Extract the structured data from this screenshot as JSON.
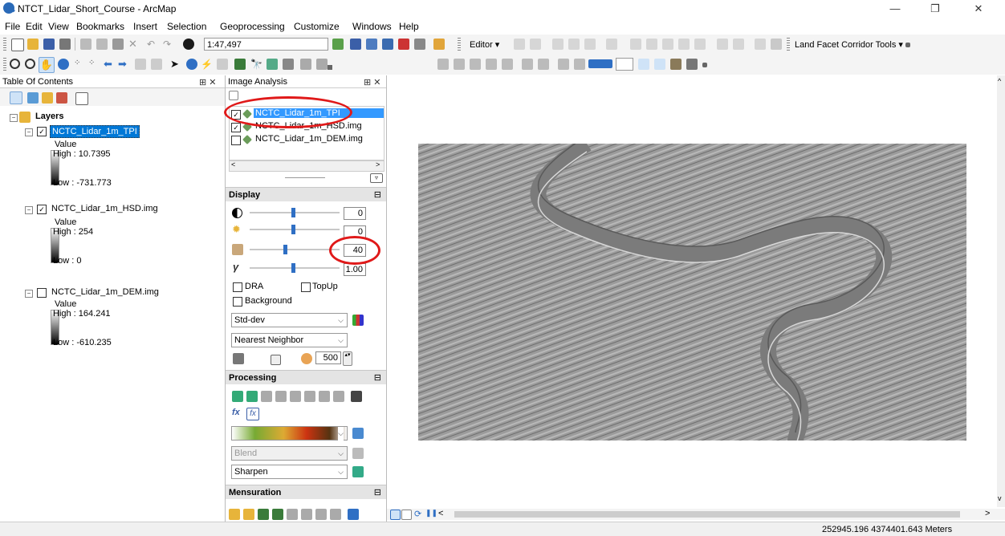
{
  "window": {
    "title": "NTCT_Lidar_Short_Course - ArcMap",
    "min": "—",
    "max": "❐",
    "close": "✕"
  },
  "menu": [
    "File",
    "Edit",
    "View",
    "Bookmarks",
    "Insert",
    "Selection",
    "Geoprocessing",
    "Customize",
    "Windows",
    "Help"
  ],
  "toolbar": {
    "scale_value": "1:47,497",
    "editor_label": "Editor ▾",
    "land_facet_label": "Land Facet Corridor Tools ▾"
  },
  "toc": {
    "title": "Table Of Contents",
    "pin": "⊞ ✕",
    "root_label": "Layers",
    "layers": [
      {
        "name": "NCTC_Lidar_1m_TPI",
        "checked": true,
        "value_label": "Value",
        "high": "High : 10.7395",
        "low": "Low : -731.773"
      },
      {
        "name": "NCTC_Lidar_1m_HSD.img",
        "checked": true,
        "value_label": "Value",
        "high": "High : 254",
        "low": "Low : 0"
      },
      {
        "name": "NCTC_Lidar_1m_DEM.img",
        "checked": false,
        "value_label": "Value",
        "high": "High : 164.241",
        "low": "Low : -610.235"
      }
    ]
  },
  "image_analysis": {
    "title": "Image Analysis",
    "layers": [
      "NCTC_Lidar_1m_TPI",
      "NCTC_Lidar_1m_HSD.img",
      "NCTC_Lidar_1m_DEM.img"
    ],
    "display": {
      "title": "Display",
      "contrast": "0",
      "brightness": "0",
      "transparency": "40",
      "gamma": "1.00",
      "dra_label": "DRA",
      "topup_label": "TopUp",
      "background_label": "Background",
      "stretch": "Std-dev",
      "resampling": "Nearest Neighbor",
      "zoom_value": "500"
    },
    "processing": {
      "title": "Processing",
      "blend": "Blend",
      "sharpen": "Sharpen"
    },
    "mensuration": {
      "title": "Mensuration"
    }
  },
  "status": {
    "coords": "252945.196 4374401.643 Meters"
  },
  "colors": {
    "accent": "#3399ff",
    "highlight": "#0078d7",
    "annotation": "#e01919"
  }
}
